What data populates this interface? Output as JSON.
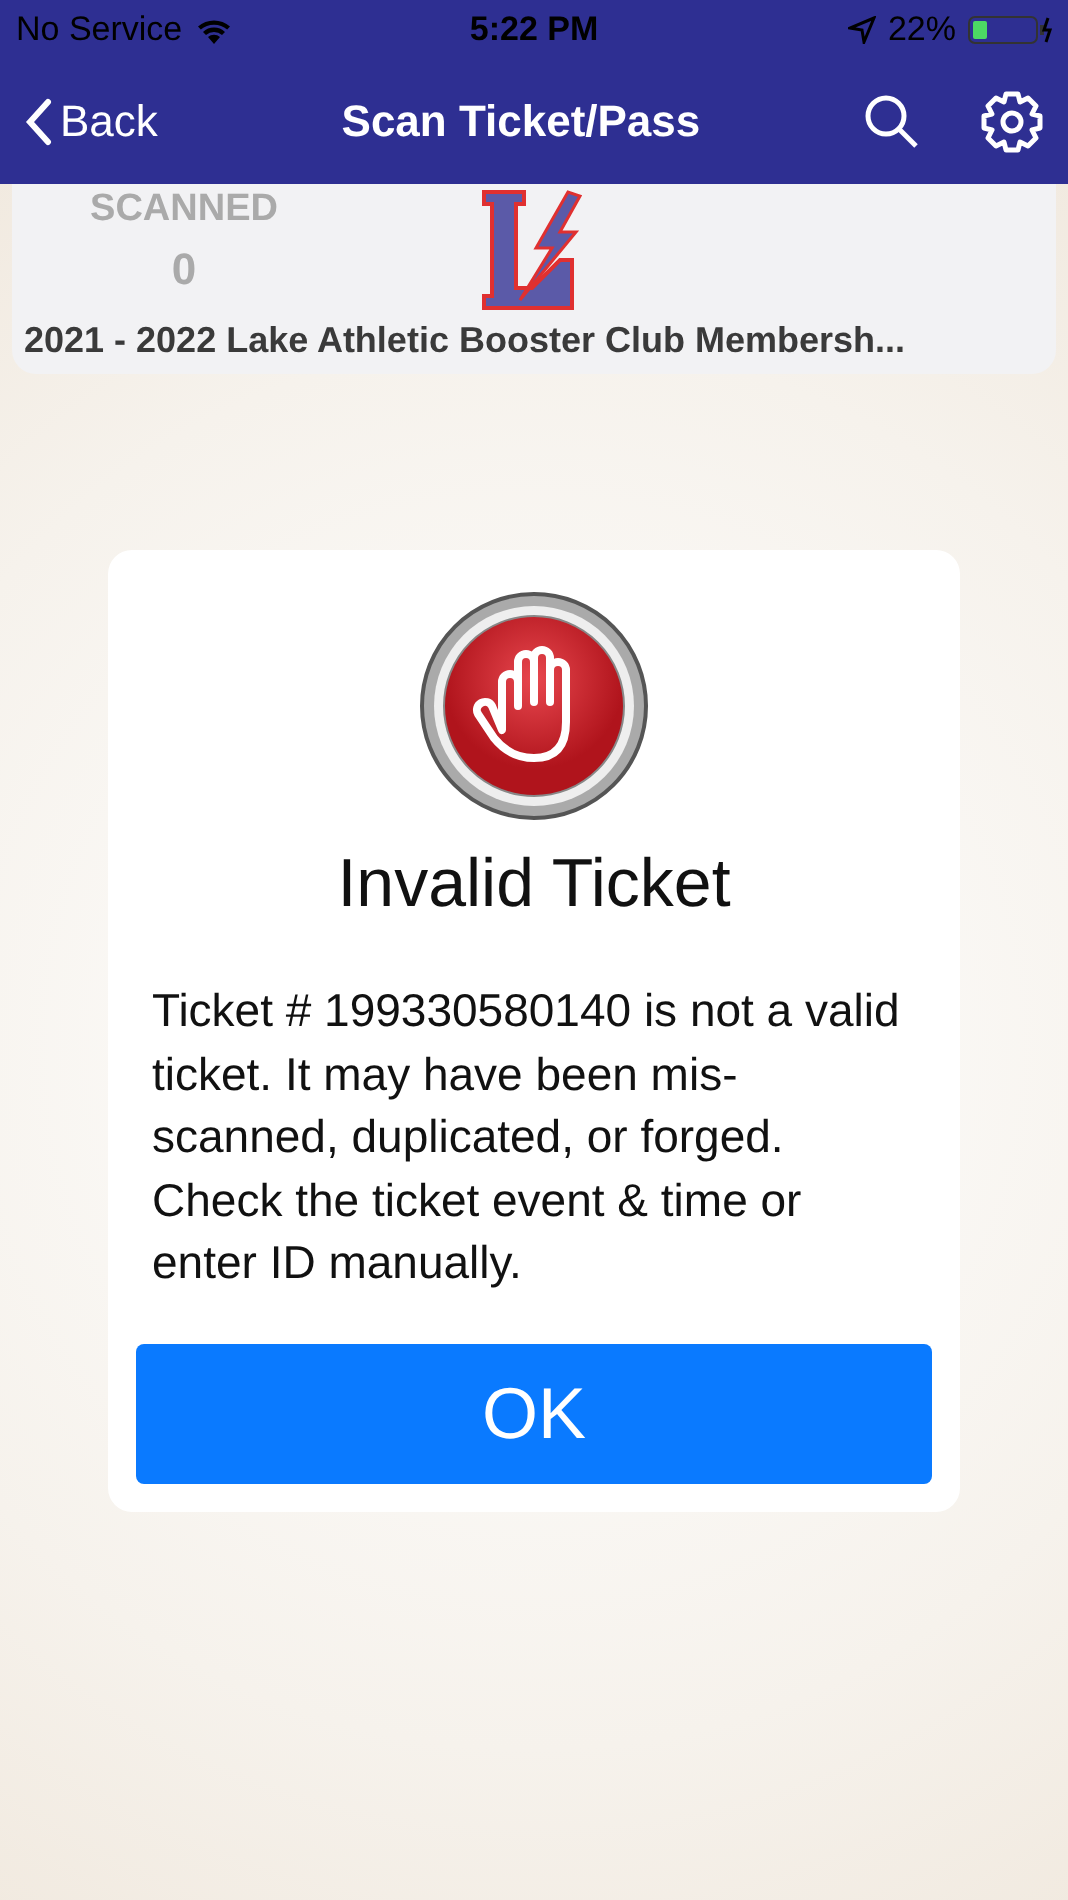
{
  "status_bar": {
    "carrier": "No Service",
    "time": "5:22 PM",
    "battery": "22%"
  },
  "nav": {
    "back": "Back",
    "title": "Scan Ticket/Pass"
  },
  "event": {
    "scanned_label": "SCANNED",
    "scanned_count": "0",
    "name": "2021 - 2022 Lake Athletic Booster Club Membersh..."
  },
  "dialog": {
    "title": "Invalid Ticket",
    "message": "Ticket # 199330580140 is not a valid ticket. It may have been mis-scanned, duplicated, or forged. Check the ticket event & time or enter ID manually.",
    "button": "OK"
  }
}
